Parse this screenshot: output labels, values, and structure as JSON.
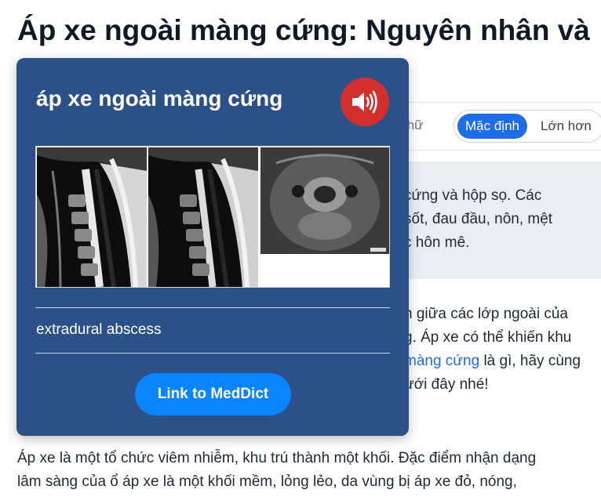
{
  "article": {
    "title_line1": "Áp xe ngoài màng cứng: Nguyên nhân và",
    "title_line2_partial": "",
    "font_size_label": "c chữ",
    "font_size_options": [
      "Mặc định",
      "Lớn hơn"
    ],
    "summary_lines": [
      "cứng và hộp sọ. Các",
      "sốt, đau đầu, nôn, mệt",
      "c hôn mê."
    ],
    "intro_lines": {
      "l1": "n giữa các lớp ngoài của",
      "l2": "g. Áp xe có thể khiến khu",
      "l3_link": "màng cứng",
      "l3_rest": " là gì, hãy cùng",
      "l4": "ưới đây nhé!"
    },
    "body_line1": "Áp xe là một tổ chức viêm nhiễm, khu trú thành một khối. Đặc điểm nhận dạng",
    "body_line2": "lâm sàng của ổ áp xe là một khối mềm, lỏng lẻo, da vùng bị áp xe đỏ, nóng,"
  },
  "popup": {
    "term": "áp xe ngoài màng cứng",
    "translation": "extradural abscess",
    "link_label": "Link to MedDict",
    "speaker_icon": "speaker-icon"
  },
  "colors": {
    "popup_bg": "#2c5088",
    "speaker_bg": "#d32f2f",
    "link_button": "#0b85ff",
    "accent": "#1d6ee6"
  }
}
